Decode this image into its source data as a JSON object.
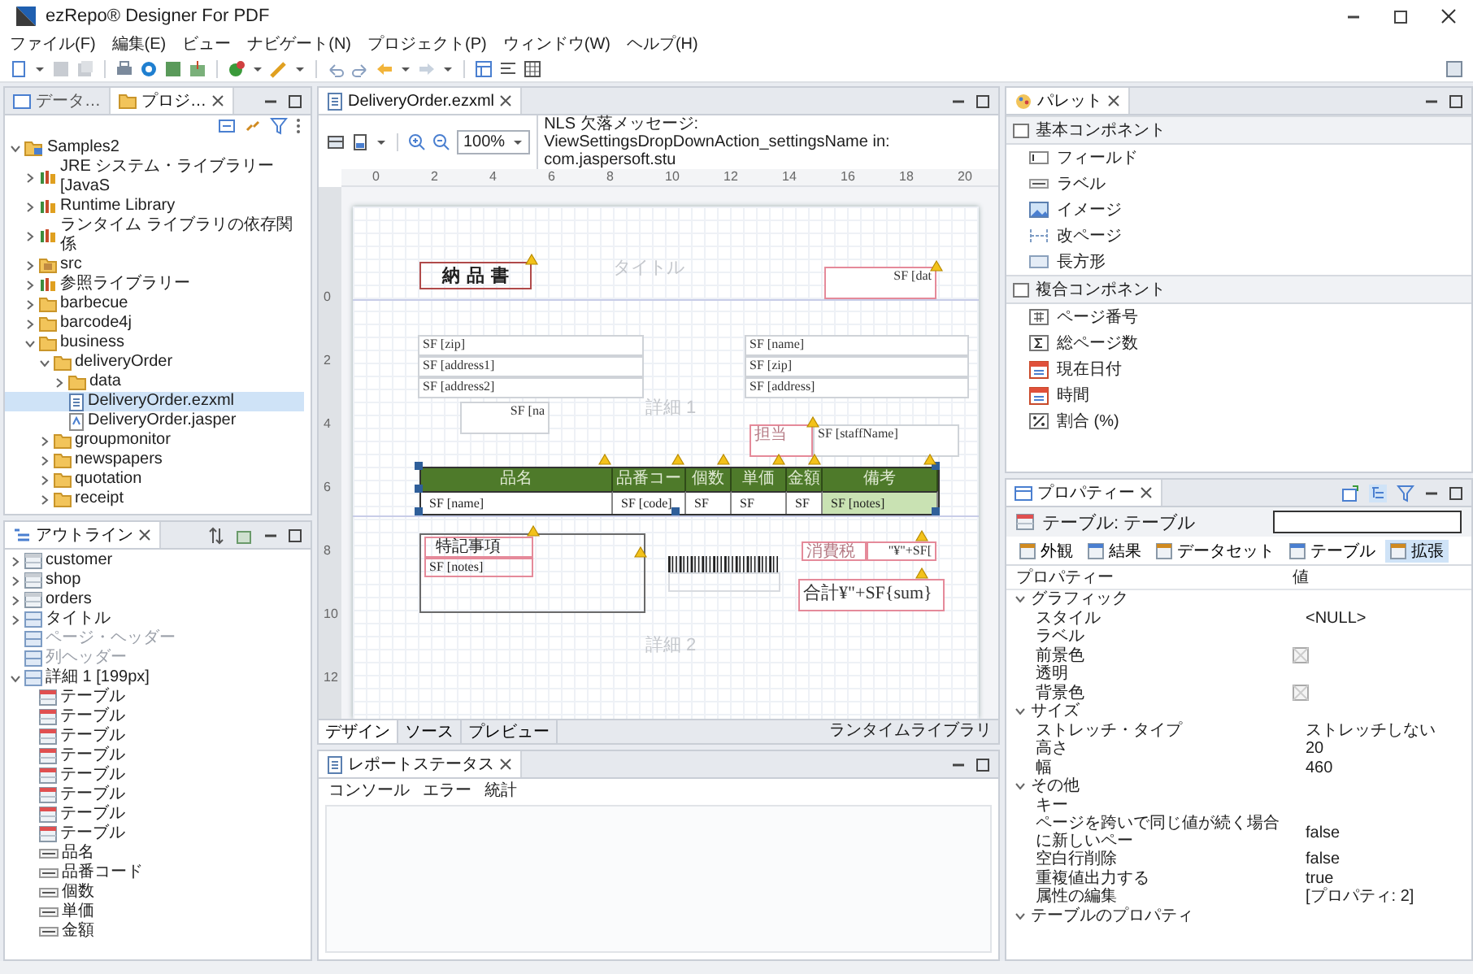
{
  "window": {
    "title": "ezRepo® Designer For PDF"
  },
  "menu": [
    "ファイル(F)",
    "編集(E)",
    "ビュー",
    "ナビゲート(N)",
    "プロジェクト(P)",
    "ウィンドウ(W)",
    "ヘルプ(H)"
  ],
  "project_panel": {
    "tabs": [
      {
        "label": "データ…",
        "selected": false
      },
      {
        "label": "プロジ…",
        "selected": true
      }
    ],
    "tree": [
      {
        "label": "Samples2",
        "kind": "project",
        "expanded": true,
        "selected": false,
        "children": [
          {
            "label": "JRE システム・ライブラリー [JavaS",
            "kind": "library",
            "expanded": false,
            "selected": false
          },
          {
            "label": "Runtime Library",
            "kind": "library",
            "expanded": false,
            "selected": false
          },
          {
            "label": "ランタイム ライブラリの依存関係",
            "kind": "library",
            "expanded": false,
            "selected": false
          },
          {
            "label": "src",
            "kind": "source",
            "expanded": false,
            "selected": false
          },
          {
            "label": "参照ライブラリー",
            "kind": "library",
            "expanded": false,
            "selected": false
          },
          {
            "label": "barbecue",
            "kind": "folder",
            "expanded": false,
            "selected": false
          },
          {
            "label": "barcode4j",
            "kind": "folder",
            "expanded": false,
            "selected": false
          },
          {
            "label": "business",
            "kind": "folder",
            "expanded": true,
            "selected": false,
            "children": [
              {
                "label": "deliveryOrder",
                "kind": "folder",
                "expanded": true,
                "selected": false,
                "children": [
                  {
                    "label": "data",
                    "kind": "folder",
                    "expanded": false,
                    "selected": false
                  },
                  {
                    "label": "DeliveryOrder.ezxml",
                    "kind": "ezxml",
                    "selected": true
                  },
                  {
                    "label": "DeliveryOrder.jasper",
                    "kind": "jasper",
                    "selected": false
                  }
                ]
              },
              {
                "label": "groupmonitor",
                "kind": "folder",
                "expanded": false,
                "selected": false
              },
              {
                "label": "newspapers",
                "kind": "folder",
                "expanded": false,
                "selected": false
              },
              {
                "label": "quotation",
                "kind": "folder",
                "expanded": false,
                "selected": false
              },
              {
                "label": "receipt",
                "kind": "folder",
                "expanded": false,
                "selected": false
              }
            ]
          }
        ]
      }
    ]
  },
  "outline": {
    "tab": "アウトライン",
    "tree": [
      {
        "label": "customer",
        "kind": "dataset",
        "expanded": false,
        "disabled": false
      },
      {
        "label": "shop",
        "kind": "dataset",
        "expanded": false,
        "disabled": false
      },
      {
        "label": "orders",
        "kind": "dataset",
        "expanded": false,
        "disabled": false
      },
      {
        "label": "タイトル",
        "kind": "band",
        "expanded": false,
        "disabled": false
      },
      {
        "label": "ページ・ヘッダー",
        "kind": "band",
        "disabled": true
      },
      {
        "label": "列ヘッダー",
        "kind": "band",
        "disabled": true
      },
      {
        "label": "詳細 1 [199px]",
        "kind": "band",
        "expanded": true,
        "disabled": false,
        "children": [
          {
            "label": "テーブル",
            "kind": "table"
          },
          {
            "label": "テーブル",
            "kind": "table"
          },
          {
            "label": "テーブル",
            "kind": "table"
          },
          {
            "label": "テーブル",
            "kind": "table"
          },
          {
            "label": "テーブル",
            "kind": "table"
          },
          {
            "label": "テーブル",
            "kind": "table"
          },
          {
            "label": "テーブル",
            "kind": "table"
          },
          {
            "label": "テーブル",
            "kind": "table"
          },
          {
            "label": "品名",
            "kind": "label"
          },
          {
            "label": "品番コード",
            "kind": "label"
          },
          {
            "label": "個数",
            "kind": "label"
          },
          {
            "label": "単価",
            "kind": "label"
          },
          {
            "label": "金額",
            "kind": "label"
          }
        ]
      }
    ]
  },
  "editor": {
    "tab": "DeliveryOrder.ezxml",
    "zoom": "100%",
    "message": "NLS 欠落メッセージ: ViewSettingsDropDownAction_settingsName in: com.jaspersoft.stu",
    "ruler_h": [
      "0",
      "2",
      "4",
      "6",
      "8",
      "10",
      "12",
      "14",
      "16",
      "18",
      "20"
    ],
    "ruler_v": [
      "0",
      "2",
      "4",
      "6",
      "8",
      "10",
      "12"
    ],
    "report": {
      "heading": "納 品 書",
      "band_labels": [
        "タイトル",
        "詳細 1",
        "詳細 2"
      ],
      "fields": [
        "SF [dat",
        "SF [zip]",
        "SF [address1]",
        "SF [address2]",
        "SF [na",
        "SF [name]",
        "SF [zip]",
        "SF [address]",
        "担当",
        "SF [staffName]",
        "消費税",
        "\"¥\"+SF[",
        "合計¥\"+SF{sum}"
      ],
      "table": {
        "headers": [
          "品名",
          "品番コー",
          "個数",
          "単価",
          "金額",
          "備考"
        ],
        "cells": [
          "SF [name]",
          "SF [code]",
          "SF",
          "SF",
          "SF",
          "SF [notes]"
        ]
      },
      "notes_box": {
        "title": "特記事項",
        "field": "SF [notes]"
      }
    },
    "bottom_tabs": [
      {
        "label": "デザイン",
        "selected": true
      },
      {
        "label": "ソース",
        "selected": false
      },
      {
        "label": "プレビュー",
        "selected": false
      }
    ],
    "runtime_label": "ランタイムライブラリ"
  },
  "report_status": {
    "tab": "レポートステータス",
    "tabs": [
      "コンソール",
      "エラー",
      "統計"
    ]
  },
  "palette": {
    "tab": "パレット",
    "groups": [
      {
        "label": "基本コンポネント",
        "items": [
          {
            "label": "フィールド",
            "kind": "field"
          },
          {
            "label": "ラベル",
            "kind": "label"
          },
          {
            "label": "イメージ",
            "kind": "image"
          },
          {
            "label": "改ページ",
            "kind": "page-break"
          },
          {
            "label": "長方形",
            "kind": "rectangle"
          }
        ]
      },
      {
        "label": "複合コンポネント",
        "items": [
          {
            "label": "ページ番号",
            "kind": "page-number"
          },
          {
            "label": "総ページ数",
            "kind": "page-count"
          },
          {
            "label": "現在日付",
            "kind": "date"
          },
          {
            "label": "時間",
            "kind": "time"
          },
          {
            "label": "割合 (%)",
            "kind": "percent"
          }
        ]
      }
    ]
  },
  "properties": {
    "tab": "プロパティー",
    "title": "テーブル: テーブル",
    "tabs": [
      {
        "label": "外観",
        "selected": false
      },
      {
        "label": "結果",
        "selected": false
      },
      {
        "label": "データセット",
        "selected": false
      },
      {
        "label": "テーブル",
        "selected": false
      },
      {
        "label": "拡張",
        "selected": true
      }
    ],
    "columns": [
      "プロパティー",
      "値"
    ],
    "groups": [
      {
        "label": "グラフィック",
        "expanded": true,
        "rows": [
          {
            "name": "スタイル",
            "kind": "text",
            "value": "<NULL>"
          },
          {
            "name": "ラベル",
            "kind": "text"
          },
          {
            "name": "前景色",
            "kind": "color"
          },
          {
            "name": "透明",
            "kind": "text"
          },
          {
            "name": "背景色",
            "kind": "color"
          }
        ]
      },
      {
        "label": "サイズ",
        "expanded": true,
        "rows": [
          {
            "name": "ストレッチ・タイプ",
            "kind": "text",
            "value": "ストレッチしない"
          },
          {
            "name": "高さ",
            "kind": "text",
            "value": "20"
          },
          {
            "name": "幅",
            "kind": "text",
            "value": "460"
          }
        ]
      },
      {
        "label": "その他",
        "expanded": true,
        "rows": [
          {
            "name": "キー",
            "kind": "text"
          },
          {
            "name": "ページを跨いで同じ値が続く場合に新しいペー",
            "kind": "text",
            "value": "false"
          },
          {
            "name": "空白行削除",
            "kind": "text",
            "value": "false"
          },
          {
            "name": "重複値出力する",
            "kind": "text",
            "value": "true"
          },
          {
            "name": "属性の編集",
            "kind": "text",
            "value": "[プロパティ: 2]"
          }
        ]
      },
      {
        "label": "テーブルのプロパティ",
        "expanded": true
      }
    ]
  }
}
